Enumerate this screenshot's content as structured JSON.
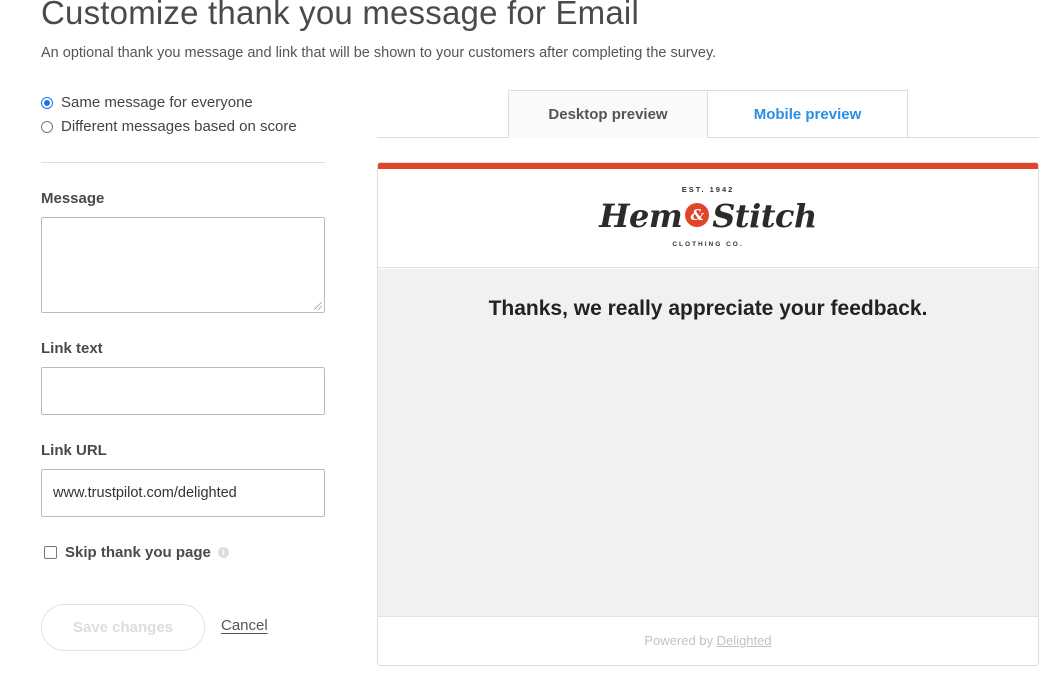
{
  "page": {
    "title": "Customize thank you message for Email",
    "subtitle": "An optional thank you message and link that will be shown to your customers after completing the survey."
  },
  "message_mode": {
    "options": [
      {
        "label": "Same message for everyone",
        "selected": true
      },
      {
        "label": "Different messages based on score",
        "selected": false
      }
    ]
  },
  "form": {
    "message_label": "Message",
    "message_value": "",
    "link_text_label": "Link text",
    "link_text_value": "",
    "link_url_label": "Link URL",
    "link_url_value": "www.trustpilot.com/delighted",
    "skip_label": "Skip thank you page",
    "skip_checked": false,
    "info_icon": "info-icon",
    "save_label": "Save changes",
    "cancel_label": "Cancel"
  },
  "preview": {
    "tabs": [
      {
        "label": "Desktop preview",
        "active": true
      },
      {
        "label": "Mobile preview",
        "active": false
      }
    ],
    "accent_color": "#e0452c",
    "logo": {
      "est": "EST. 1942",
      "name_left": "Hem",
      "ampersand": "&",
      "name_right": "Stitch",
      "sub": "CLOTHING CO."
    },
    "thanks_text": "Thanks, we really appreciate your feedback.",
    "powered_prefix": "Powered by",
    "powered_link": "Delighted"
  }
}
